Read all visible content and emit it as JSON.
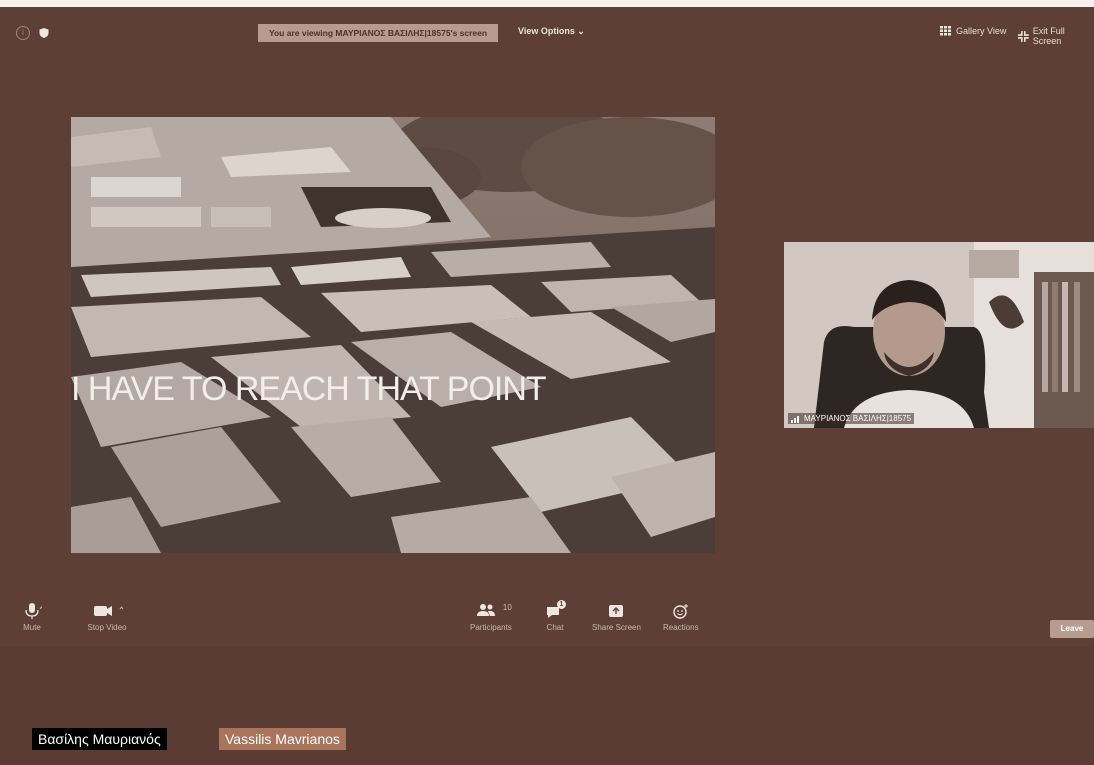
{
  "banner": {
    "text": "You are viewing ΜΑΥΡΙΑΝΟΣ ΒΑΣΙΛΗΣ|18575's screen"
  },
  "view_options": {
    "label": "View Options ⌄"
  },
  "gallery_view": {
    "label": "Gallery View"
  },
  "exit_fullscreen": {
    "label": "Exit Full Screen"
  },
  "shared_screen": {
    "caption": "I HAVE TO REACH THAT POINT"
  },
  "self_video": {
    "name": "ΜΑΥΡΙΑΝΟΣ ΒΑΣΙΛΗΣ|18575"
  },
  "toolbar": {
    "mute": "Mute",
    "stop_video": "Stop Video",
    "participants": "Participants",
    "participants_count": "10",
    "chat": "Chat",
    "chat_badge": "1",
    "share_screen": "Share Screen",
    "reactions": "Reactions",
    "leave": "Leave"
  },
  "name_tags": {
    "greek": "Βασίλης Μαυριανός",
    "latin": "Vassilis Mavrianos"
  },
  "colors": {
    "background": "#5a3c35",
    "banner": "#b79b90",
    "name_tag_latin": "#a8745c",
    "name_tag_greek": "#000000"
  },
  "icons": [
    "info-icon",
    "shield-icon",
    "gallery-icon",
    "exit-fullscreen-icon",
    "microphone-icon",
    "video-camera-icon",
    "participants-icon",
    "chat-icon",
    "share-screen-icon",
    "reactions-icon",
    "signal-icon"
  ]
}
